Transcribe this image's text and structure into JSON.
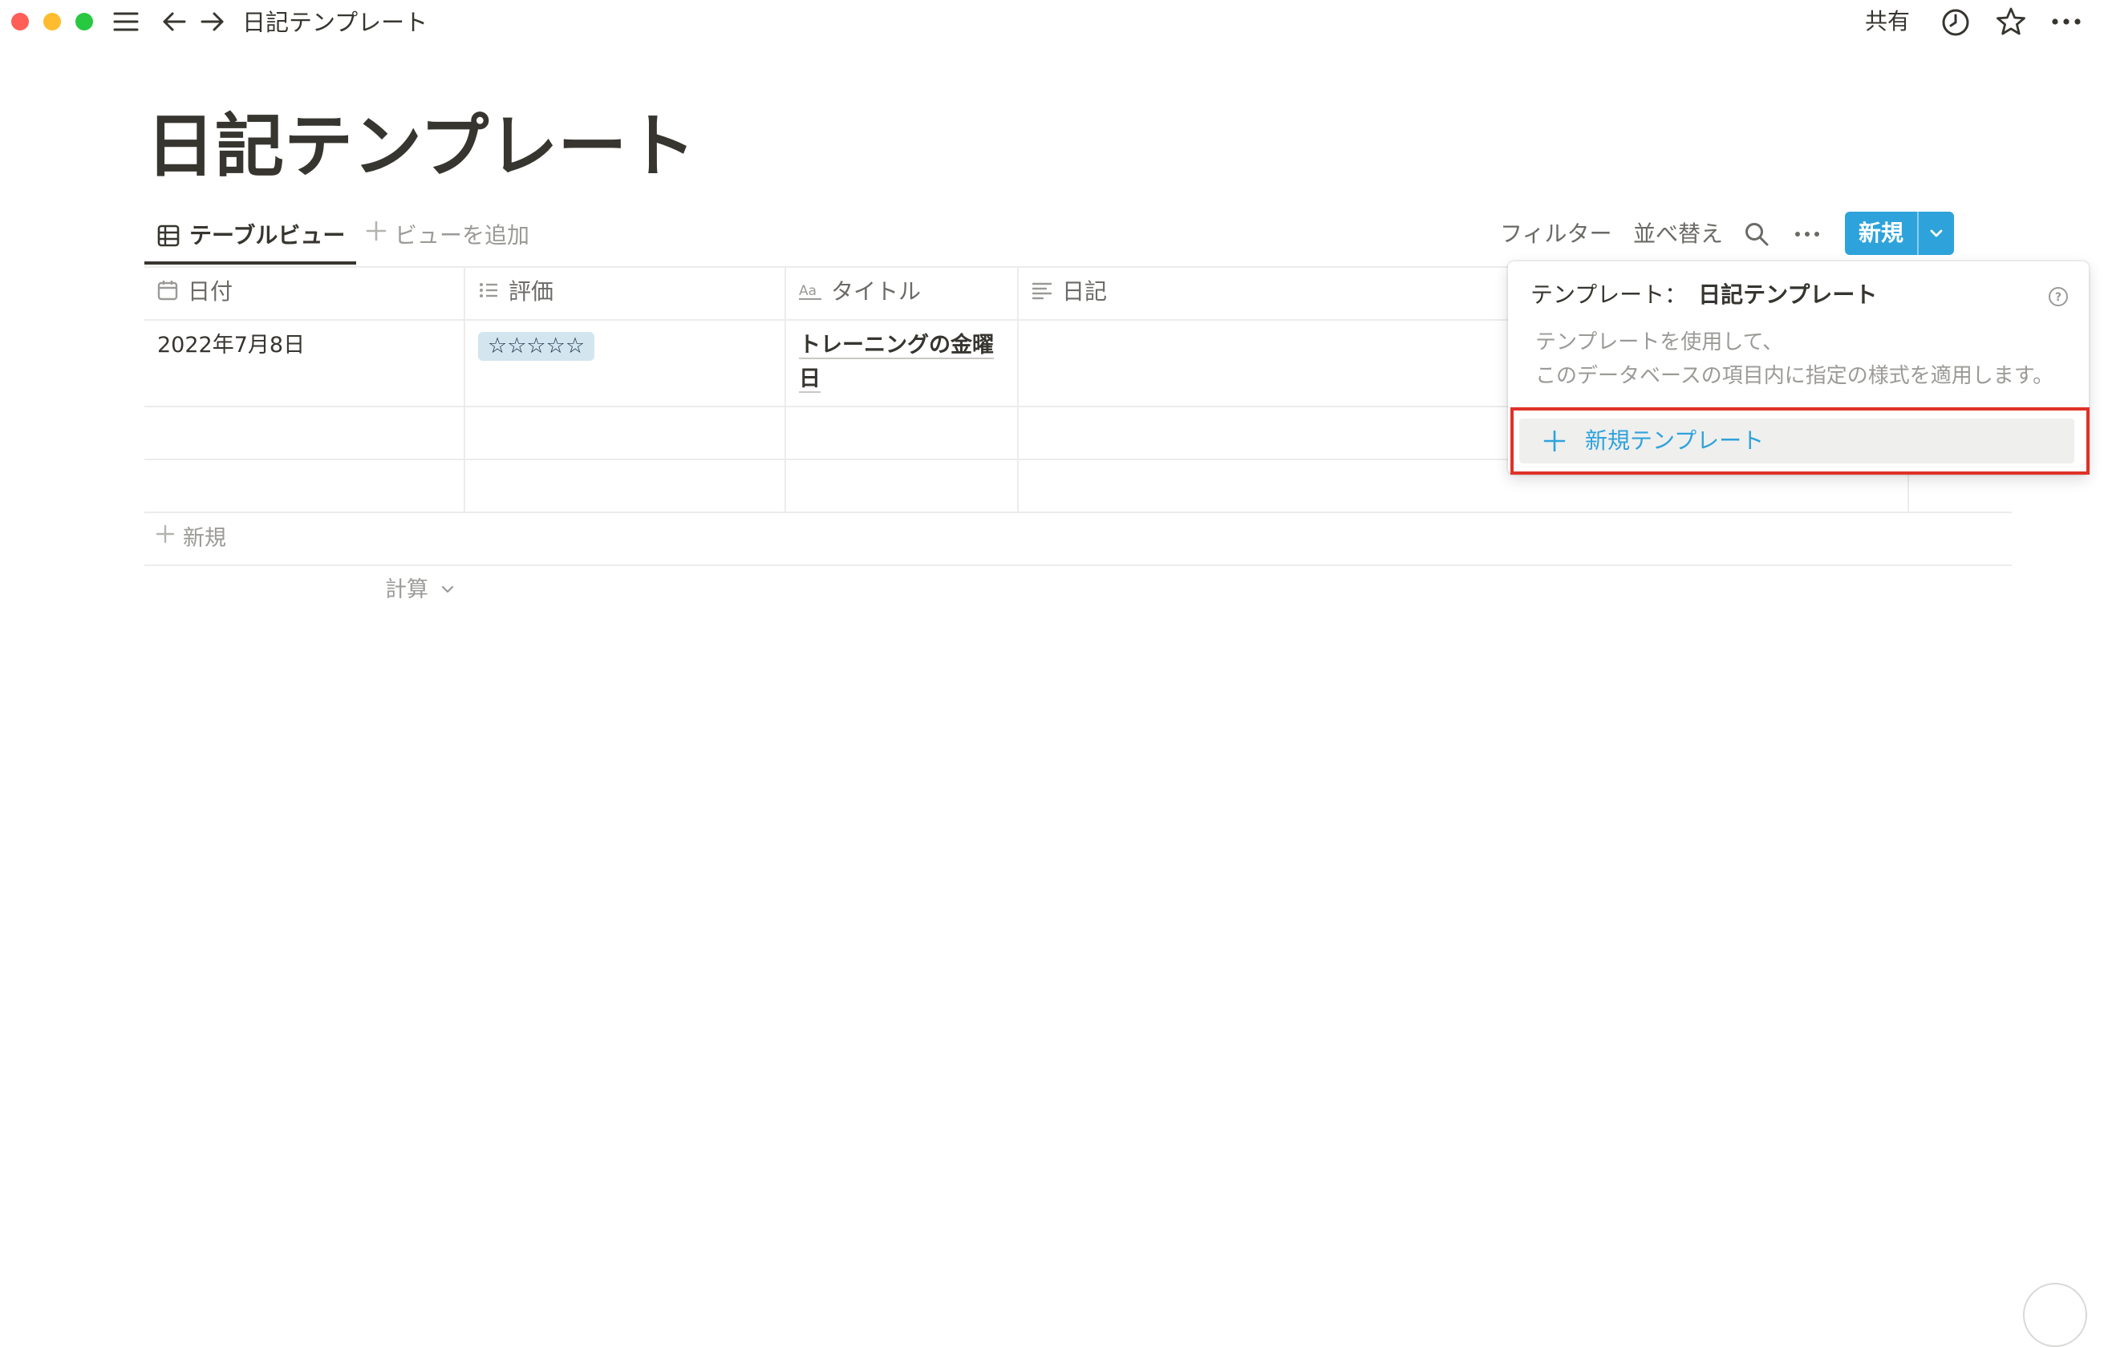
{
  "titlebar": {
    "breadcrumb": "日記テンプレート",
    "share_label": "共有"
  },
  "page": {
    "title": "日記テンプレート"
  },
  "views": {
    "active_tab": "テーブルビュー",
    "add_view": "ビューを追加"
  },
  "toolbar": {
    "filter": "フィルター",
    "sort": "並べ替え",
    "new_label": "新規"
  },
  "table": {
    "columns": [
      {
        "label": "日付",
        "icon": "calendar-icon"
      },
      {
        "label": "評価",
        "icon": "list-icon"
      },
      {
        "label": "タイトル",
        "icon": "text-aa-icon"
      },
      {
        "label": "日記",
        "icon": "paragraph-icon"
      }
    ],
    "rows": [
      {
        "date": "2022年7月8日",
        "rating": "☆☆☆☆☆",
        "title": "トレーニングの金曜日",
        "diary": ""
      },
      {
        "date": "",
        "rating": "",
        "title": "",
        "diary": ""
      },
      {
        "date": "",
        "rating": "",
        "title": "",
        "diary": ""
      }
    ],
    "add_row": "新規",
    "calculate": "計算"
  },
  "template_popup": {
    "prefix": "テンプレート：",
    "name": "日記テンプレート",
    "description_line1": "テンプレートを使用して、",
    "description_line2": "このデータベースの項目内に指定の様式を適用します。",
    "new_template": "新規テンプレート"
  },
  "colors": {
    "accent": "#2ea3db",
    "highlight_border": "#e03128",
    "rating_tag_bg": "#d3e5ef"
  }
}
